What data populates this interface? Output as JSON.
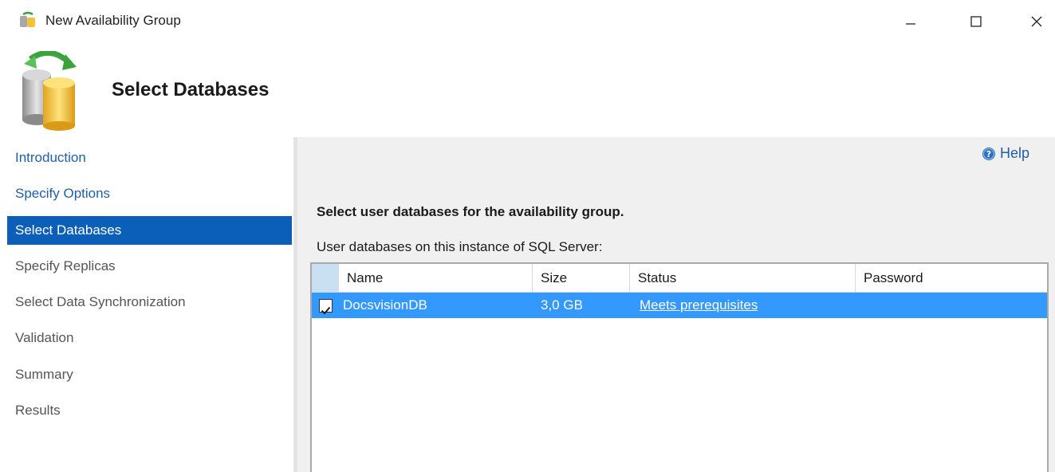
{
  "window": {
    "title": "New Availability Group",
    "icon": "availability-group-icon"
  },
  "header": {
    "title": "Select Databases",
    "icon": "database-sync-icon"
  },
  "sidebar": {
    "items": [
      {
        "label": "Introduction",
        "state": "link"
      },
      {
        "label": "Specify Options",
        "state": "link"
      },
      {
        "label": "Select Databases",
        "state": "active"
      },
      {
        "label": "Specify Replicas",
        "state": "disabled"
      },
      {
        "label": "Select Data Synchronization",
        "state": "disabled"
      },
      {
        "label": "Validation",
        "state": "disabled"
      },
      {
        "label": "Summary",
        "state": "disabled"
      },
      {
        "label": "Results",
        "state": "disabled"
      }
    ]
  },
  "main": {
    "help_label": "Help",
    "heading": "Select user databases for the availability group.",
    "table_caption": "User databases on this instance of SQL Server:",
    "table": {
      "columns": [
        "Name",
        "Size",
        "Status",
        "Password"
      ],
      "rows": [
        {
          "checked": true,
          "name": "DocsvisionDB",
          "size": "3,0 GB",
          "status": "Meets prerequisites",
          "password": ""
        }
      ]
    }
  },
  "colors": {
    "selection": "#0c5fb8",
    "row_highlight": "#3399ff",
    "link": "#1f5fa8"
  }
}
